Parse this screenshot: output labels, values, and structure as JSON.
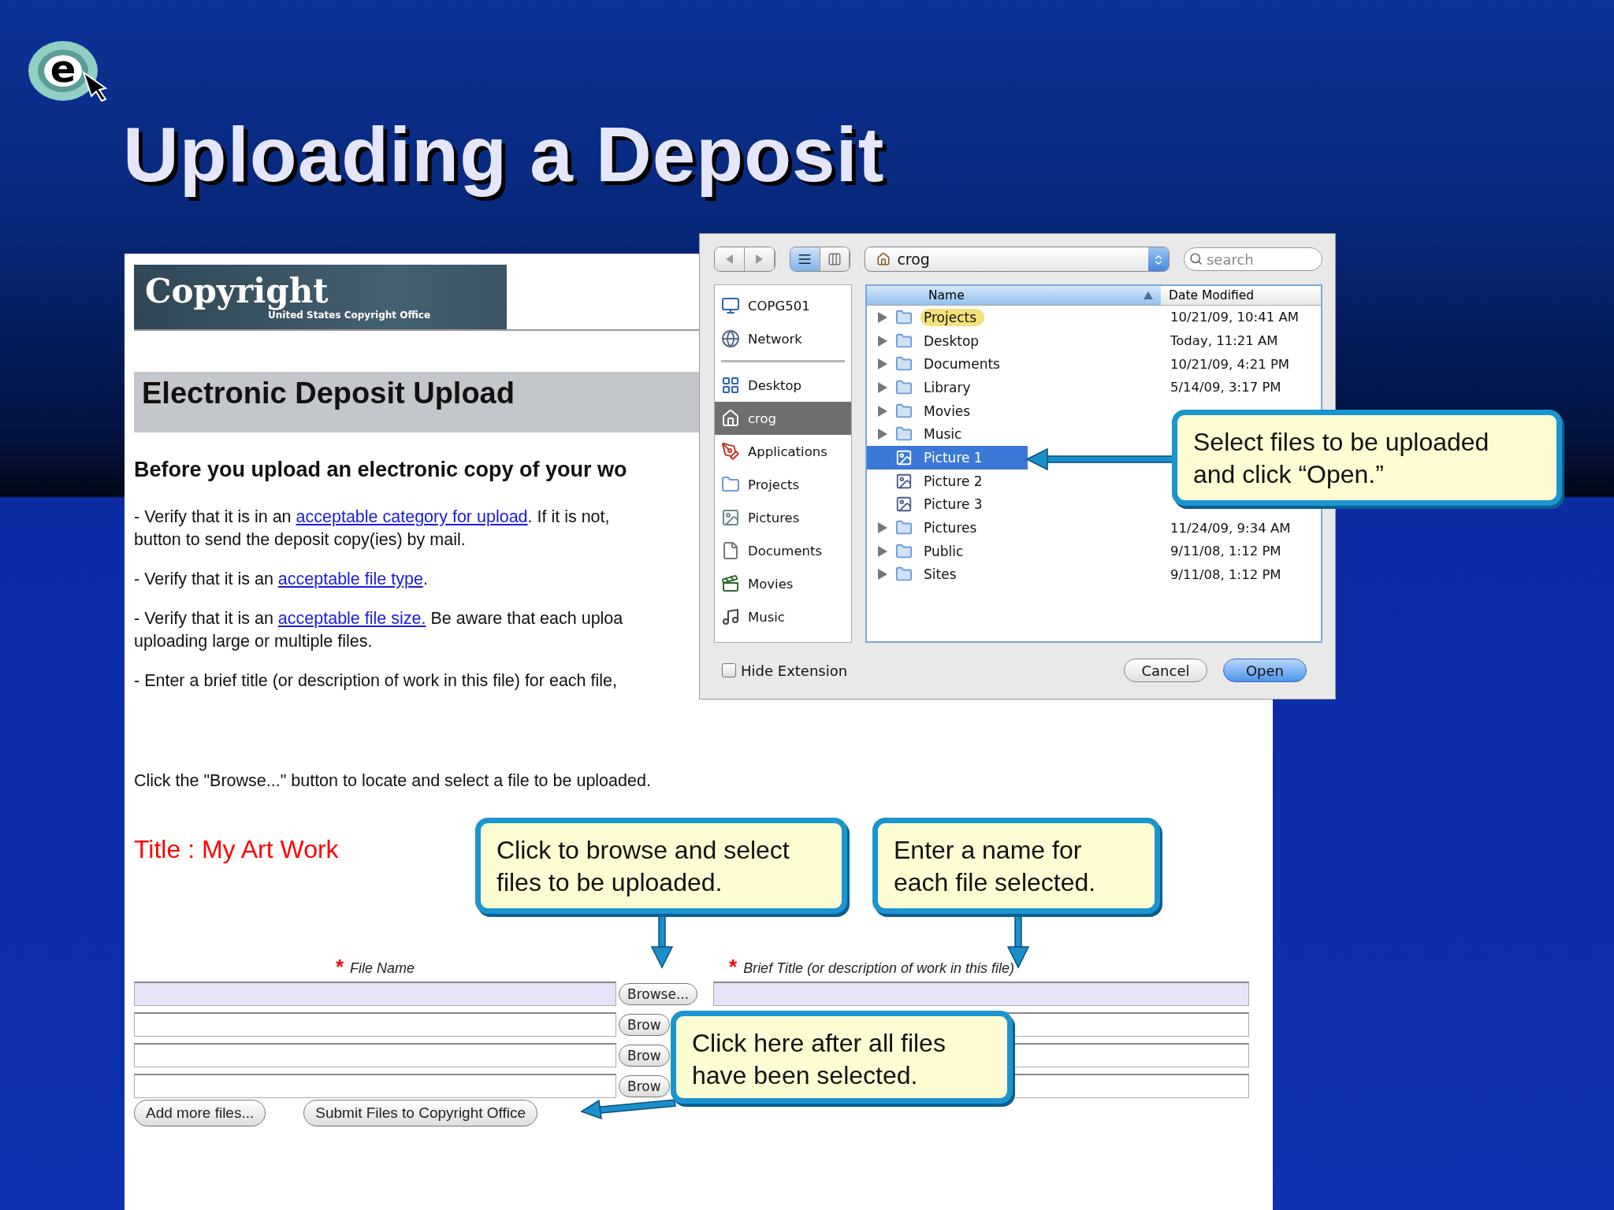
{
  "logo": {
    "letter": "e"
  },
  "title": "Uploading a Deposit",
  "web_page": {
    "banner": {
      "wordmark": "Copyright",
      "subtitle": "United States Copyright Office"
    },
    "heading": "Electronic Deposit Upload",
    "intro": "Before you upload an electronic copy of your wo",
    "paragraphs": [
      {
        "lines": [
          [
            {
              "text": "- Verify that it is in an "
            },
            {
              "text": "acceptable category for upload",
              "link": true
            },
            {
              "text": ". If it is not,"
            }
          ],
          [
            {
              "text": "button to send the deposit copy(ies) by mail."
            }
          ]
        ]
      },
      {
        "lines": [
          [
            {
              "text": "- Verify that it is an "
            },
            {
              "text": "acceptable file type",
              "link": true
            },
            {
              "text": "."
            }
          ]
        ]
      },
      {
        "lines": [
          [
            {
              "text": "- Verify that it is an "
            },
            {
              "text": "acceptable file size.",
              "link": true
            },
            {
              "text": " Be aware that each uploa"
            }
          ],
          [
            {
              "text": "uploading large or multiple files."
            }
          ]
        ]
      },
      {
        "lines": [
          [
            {
              "text": "- Enter a brief title (or description of work in this file) for each file,"
            }
          ]
        ]
      }
    ],
    "instruction": "Click the \"Browse...\" button to locate and select a file to be uploaded.",
    "work_title": "Title : My Art Work",
    "form": {
      "required_mark": "*",
      "file_column": "File Name",
      "title_column": "Brief Title (or description of work in this file)",
      "rows": [
        {
          "browse": "Browse...",
          "focused": true
        },
        {
          "browse": "Brow",
          "focused": false
        },
        {
          "browse": "Brow",
          "focused": false
        },
        {
          "browse": "Brow",
          "focused": false
        }
      ],
      "buttons": [
        "Add more files...",
        "Submit Files to Copyright Office"
      ]
    }
  },
  "dialog": {
    "views": [
      {
        "kind": "list",
        "selected": true
      },
      {
        "kind": "columns",
        "selected": false
      }
    ],
    "location": "crog",
    "search": {
      "placeholder": "search"
    },
    "sidebar": {
      "sections": [
        {
          "items": [
            {
              "label": "COPG501",
              "selected": false
            },
            {
              "label": "Network",
              "selected": false
            }
          ]
        },
        {
          "items": [
            {
              "label": "Desktop",
              "selected": false
            },
            {
              "label": "crog",
              "selected": true
            },
            {
              "label": "Applications",
              "selected": false
            },
            {
              "label": "Projects",
              "selected": false
            },
            {
              "label": "Pictures",
              "selected": false
            },
            {
              "label": "Documents",
              "selected": false
            },
            {
              "label": "Movies",
              "selected": false
            },
            {
              "label": "Music",
              "selected": false
            }
          ]
        }
      ]
    },
    "columns": [
      "Name",
      "Date Modified"
    ],
    "files": [
      {
        "kind": "folder",
        "name": "Projects",
        "date": "10/21/09, 10:41 AM",
        "selected": false,
        "color": "#f4e07a"
      },
      {
        "kind": "folder",
        "name": "Desktop",
        "date": "Today, 11:21 AM",
        "selected": false
      },
      {
        "kind": "folder",
        "name": "Documents",
        "date": "10/21/09, 4:21 PM",
        "selected": false
      },
      {
        "kind": "folder",
        "name": "Library",
        "date": "5/14/09, 3:17 PM",
        "selected": false
      },
      {
        "kind": "folder",
        "name": "Movies",
        "selected": false
      },
      {
        "kind": "folder",
        "name": "Music",
        "selected": false
      },
      {
        "kind": "file",
        "name": "Picture 1",
        "selected": true
      },
      {
        "kind": "file",
        "name": "Picture 2",
        "selected": false
      },
      {
        "kind": "file",
        "name": "Picture 3",
        "selected": false
      },
      {
        "kind": "folder",
        "name": "Pictures",
        "date": "11/24/09, 9:34 AM",
        "selected": false
      },
      {
        "kind": "folder",
        "name": "Public",
        "date": "9/11/08, 1:12 PM",
        "selected": false
      },
      {
        "kind": "folder",
        "name": "Sites",
        "date": "9/11/08, 1:12 PM",
        "selected": false
      }
    ],
    "hide_extension": {
      "label": "Hide Extension",
      "checked": false
    },
    "buttons": [
      {
        "label": "Cancel",
        "default": false
      },
      {
        "label": "Open",
        "default": true
      }
    ]
  },
  "callouts": [
    {
      "lines": [
        "Select files to be uploaded",
        "and click “Open.”"
      ]
    },
    {
      "lines": [
        "Click to browse and select",
        "files to be uploaded."
      ]
    },
    {
      "lines": [
        "Enter a name for",
        "each file selected."
      ]
    },
    {
      "lines": [
        "Click here after all files",
        "have been selected."
      ]
    }
  ]
}
